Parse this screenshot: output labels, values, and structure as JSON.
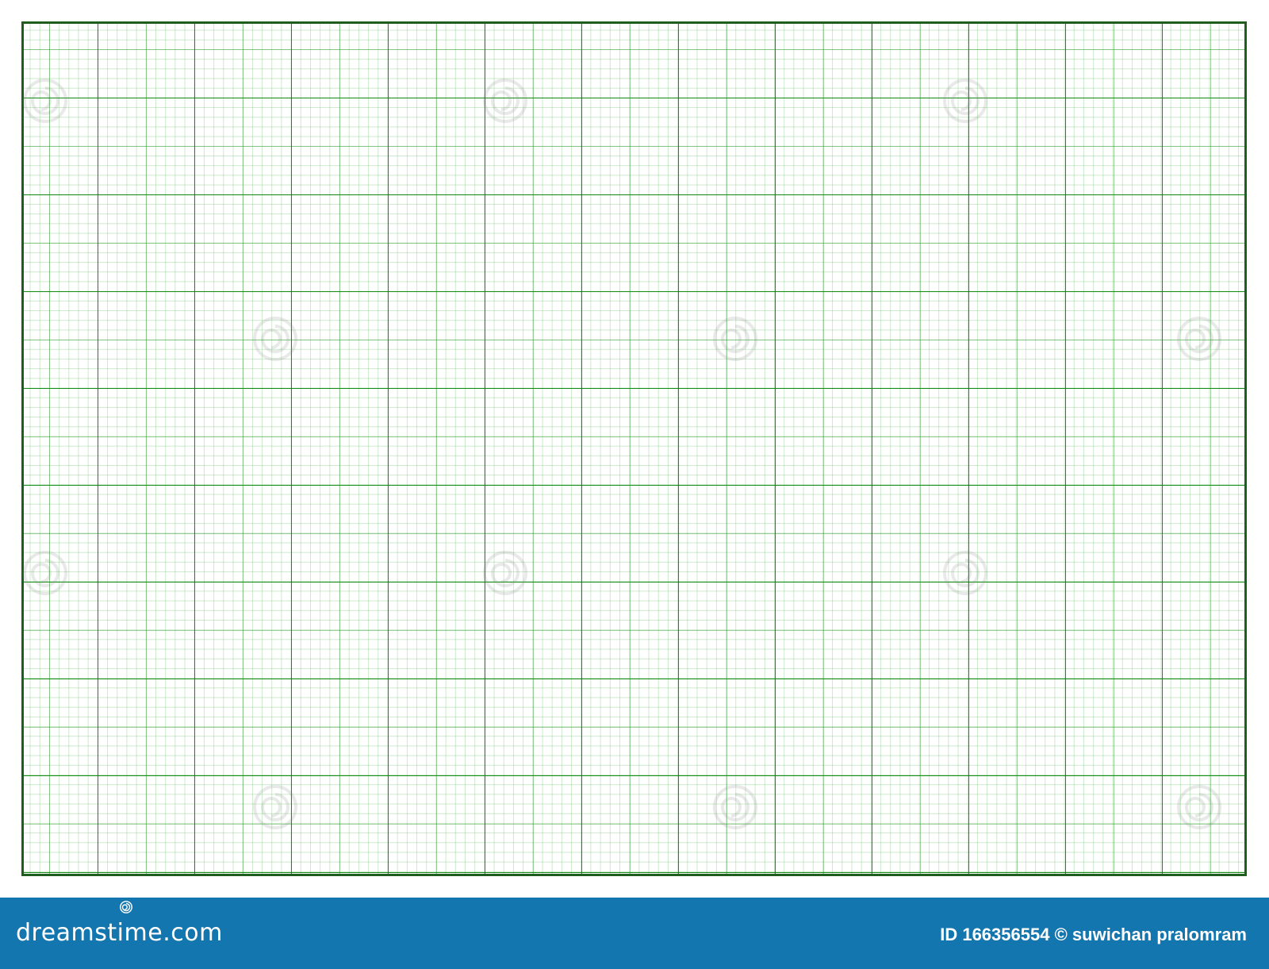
{
  "paper": {
    "grid_color": "#1f8a1f",
    "border_color": "#1f5e1f",
    "background": "#ffffff"
  },
  "footer": {
    "background": "#1476ae",
    "brand_logo": "dreamstime.com",
    "id_label": "ID",
    "image_id": "166356554",
    "copyright_symbol": "©",
    "author": "suwichan pralomram"
  },
  "icons": {
    "watermark": "dreamstime-swirl-icon"
  }
}
